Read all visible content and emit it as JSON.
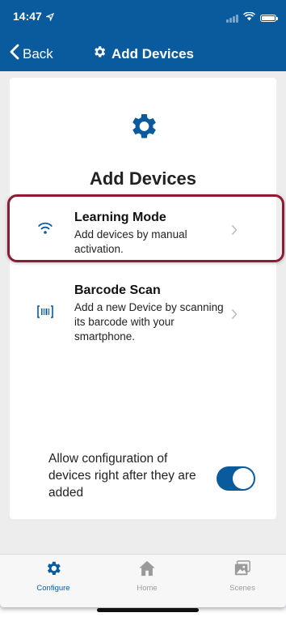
{
  "status_bar": {
    "time": "14:47"
  },
  "nav": {
    "back_label": "Back",
    "title": "Add Devices"
  },
  "card": {
    "title": "Add Devices",
    "options": [
      {
        "title": "Learning Mode",
        "description": "Add devices by manual activation.",
        "icon": "wifi-icon"
      },
      {
        "title": "Barcode Scan",
        "description": "Add a new Device by scanning its barcode with your smartphone.",
        "icon": "barcode-icon"
      }
    ],
    "toggle": {
      "label": "Allow configuration of devices right after they are added",
      "on": true
    }
  },
  "tabs": [
    {
      "label": "Configure",
      "icon": "gear-icon",
      "active": true
    },
    {
      "label": "Home",
      "icon": "home-icon",
      "active": false
    },
    {
      "label": "Scenes",
      "icon": "scenes-icon",
      "active": false
    }
  ],
  "colors": {
    "accent": "#0a5a9e",
    "highlight": "#8c1c36",
    "background": "#ededed"
  }
}
